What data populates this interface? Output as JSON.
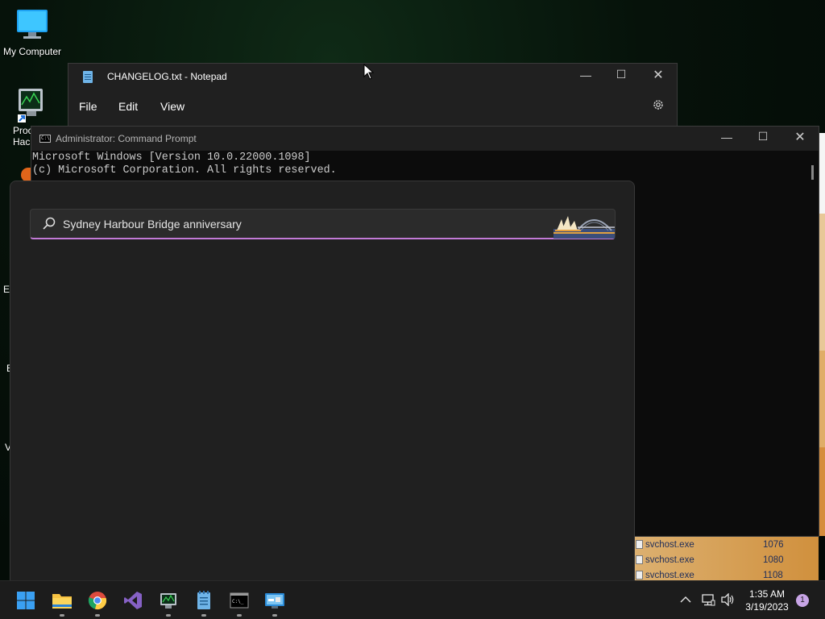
{
  "desktop": {
    "icons": [
      {
        "label": "My Computer",
        "icon": "computer-icon"
      },
      {
        "label": "Proc\nHack",
        "icon": "process-hacker-icon"
      }
    ],
    "partial_labels": [
      "Ei",
      "E",
      "V"
    ]
  },
  "background_process_list": [
    {
      "name": "svchost.exe",
      "pid": "1076"
    },
    {
      "name": "svchost.exe",
      "pid": "1080"
    },
    {
      "name": "svchost.exe",
      "pid": "1108"
    }
  ],
  "notepad": {
    "title": "CHANGELOG.txt - Notepad",
    "menu": [
      "File",
      "Edit",
      "View"
    ],
    "icons": {
      "app": "notepad-icon",
      "settings": "gear-icon"
    }
  },
  "cmd": {
    "title": "Administrator: Command Prompt",
    "lines": [
      "Microsoft Windows [Version 10.0.22000.1098]",
      "(c) Microsoft Corporation. All rights reserved."
    ]
  },
  "search": {
    "query": "Sydney Harbour Bridge anniversary",
    "highlight_icon": "sydney-harbour-bridge-illustration",
    "accent": "#c27ad6"
  },
  "taskbar": {
    "apps": [
      "start-icon",
      "file-explorer-icon",
      "chrome-icon",
      "visual-studio-icon",
      "process-hacker-icon",
      "notepad-icon",
      "terminal-icon",
      "control-panel-icon"
    ],
    "tray": [
      "chevron-up-icon",
      "network-icon",
      "volume-icon"
    ],
    "time": "1:35 AM",
    "date": "3/19/2023",
    "notifications": "1"
  }
}
